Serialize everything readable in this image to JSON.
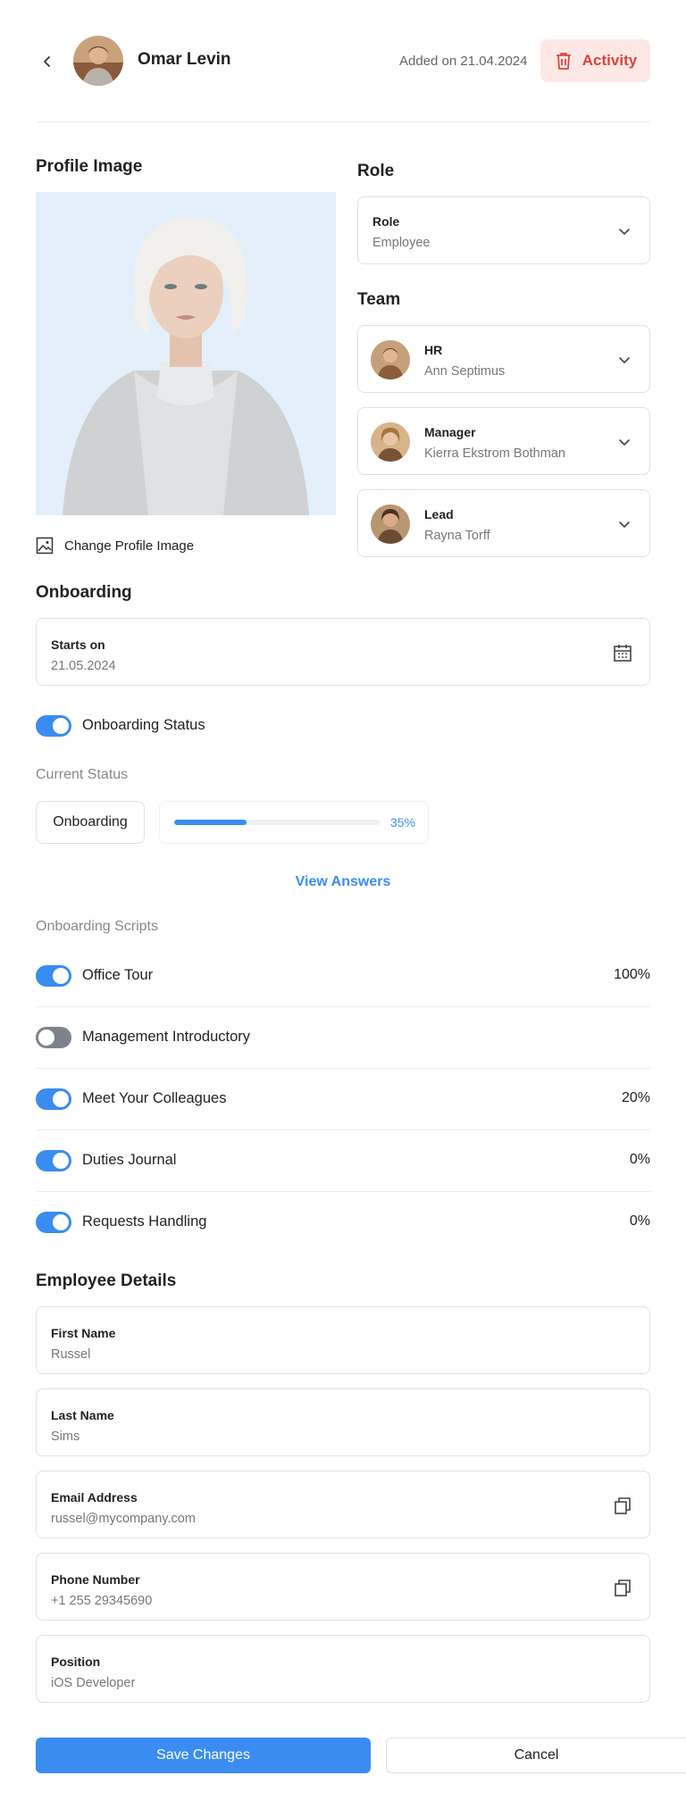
{
  "header": {
    "name": "Omar Levin",
    "added_on": "Added on 21.04.2024",
    "activity_label": "Activity"
  },
  "profile": {
    "title": "Profile Image",
    "change_label": "Change Profile Image"
  },
  "role": {
    "title": "Role",
    "label": "Role",
    "value": "Employee"
  },
  "team": {
    "title": "Team",
    "members": [
      {
        "label": "HR",
        "value": "Ann Septimus"
      },
      {
        "label": "Manager",
        "value": "Kierra Ekstrom Bothman"
      },
      {
        "label": "Lead",
        "value": "Rayna Torff"
      }
    ]
  },
  "onboarding": {
    "title": "Onboarding",
    "starts_label": "Starts on",
    "starts_value": "21.05.2024",
    "status_toggle_label": "Onboarding Status",
    "status_toggle_on": true,
    "current_status_title": "Current Status",
    "current_status_value": "Onboarding",
    "progress_percent": 35,
    "progress_label": "35%",
    "view_answers": "View Answers",
    "scripts_title": "Onboarding Scripts",
    "scripts": [
      {
        "label": "Office Tour",
        "on": true,
        "pct": "100%"
      },
      {
        "label": "Management Introductory",
        "on": false,
        "pct": ""
      },
      {
        "label": "Meet Your Colleagues",
        "on": true,
        "pct": "20%"
      },
      {
        "label": "Duties Journal",
        "on": true,
        "pct": "0%"
      },
      {
        "label": "Requests Handling",
        "on": true,
        "pct": "0%"
      }
    ]
  },
  "details": {
    "title": "Employee Details",
    "fields": [
      {
        "label": "First Name",
        "value": "Russel"
      },
      {
        "label": "Last Name",
        "value": "Sims"
      },
      {
        "label": "Email Address",
        "value": "russel@mycompany.com"
      },
      {
        "label": "Phone Number",
        "value": "+1 255 29345690"
      },
      {
        "label": "Position",
        "value": "iOS Developer"
      }
    ]
  },
  "actions": {
    "save": "Save Changes",
    "cancel": "Cancel"
  },
  "colors": {
    "accent": "#3b8cf0",
    "danger": "#d9453b",
    "danger_bg": "#fde8e6"
  }
}
